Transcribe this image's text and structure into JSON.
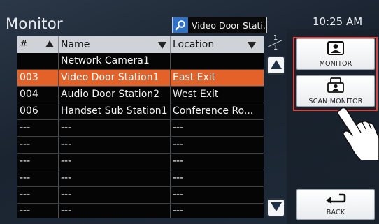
{
  "header": {
    "title": "Monitor",
    "search_value": "Video Door Stati...",
    "clock": "10:25 AM"
  },
  "table": {
    "columns": [
      "#",
      "Name",
      "Location"
    ],
    "rows": [
      {
        "num": "",
        "name": "Network Camera1",
        "location": "",
        "selected": false
      },
      {
        "num": "003",
        "name": "Video Door Station1",
        "location": "East Exit",
        "selected": true
      },
      {
        "num": "004",
        "name": "Audio Door Station2",
        "location": "West Exit",
        "selected": false
      },
      {
        "num": "006",
        "name": "Handset Sub Station1",
        "location": "Conference Ro...",
        "selected": false
      },
      {
        "num": "---",
        "name": "---",
        "location": "---",
        "selected": false
      },
      {
        "num": "---",
        "name": "---",
        "location": "---",
        "selected": false
      },
      {
        "num": "---",
        "name": "---",
        "location": "---",
        "selected": false
      },
      {
        "num": "---",
        "name": "---",
        "location": "---",
        "selected": false
      },
      {
        "num": "---",
        "name": "---",
        "location": "---",
        "selected": false
      },
      {
        "num": "---",
        "name": "---",
        "location": "---",
        "selected": false
      }
    ]
  },
  "pager": {
    "current": "1",
    "total": "1"
  },
  "buttons": {
    "monitor": "MONITOR",
    "scan_monitor": "SCAN MONITOR",
    "back": "BACK"
  },
  "colors": {
    "selected_row": "#e3622a",
    "highlight_frame": "#d9443c",
    "search_icon": "#2f71c9"
  },
  "icons": {
    "search": "magnifier-icon",
    "monitor": "person-monitor-icon",
    "scan_monitor": "scan-monitor-icon",
    "back": "return-arrow-icon",
    "scroll_up": "triangle-up-icon",
    "scroll_down": "triangle-down-icon"
  }
}
